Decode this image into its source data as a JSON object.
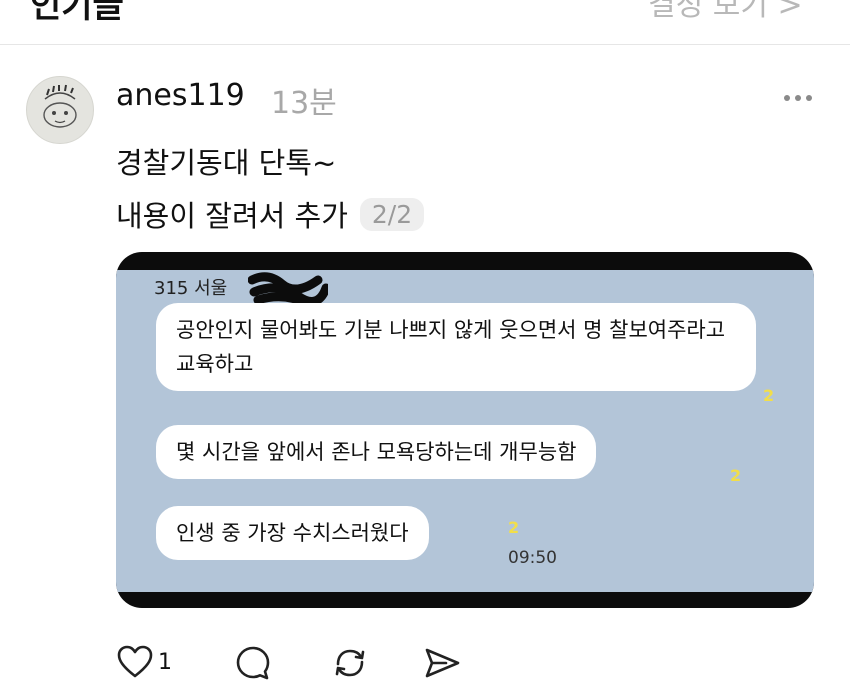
{
  "header": {
    "title_partial": "인기글",
    "right_link_partial": "결정 보기 >"
  },
  "post": {
    "author": "anes119",
    "time": "13분",
    "line1": "경찰기동대 단톡~",
    "line2": "내용이 잘려서 추가",
    "page_indicator": "2/2",
    "image": {
      "sender": "315 서울",
      "messages": [
        {
          "text": "공안인지 물어봐도 기분 나쁘지 않게 웃으면서 명 찰보여주라고 교육하고",
          "unread": "2"
        },
        {
          "text": "몇 시간을 앞에서 존나 모욕당하는데 개무능함",
          "unread": "2"
        },
        {
          "text": "인생 중 가장 수치스러웠다",
          "unread": "2"
        }
      ],
      "timestamp": "09:50"
    },
    "actions": {
      "like_count": "1",
      "icons": [
        "heart-icon",
        "comment-icon",
        "repost-icon",
        "share-icon"
      ]
    }
  },
  "colors": {
    "chat_background": "#b3c5d8",
    "unread_badge": "#f2de4a",
    "muted_text": "#a8a8a8"
  }
}
